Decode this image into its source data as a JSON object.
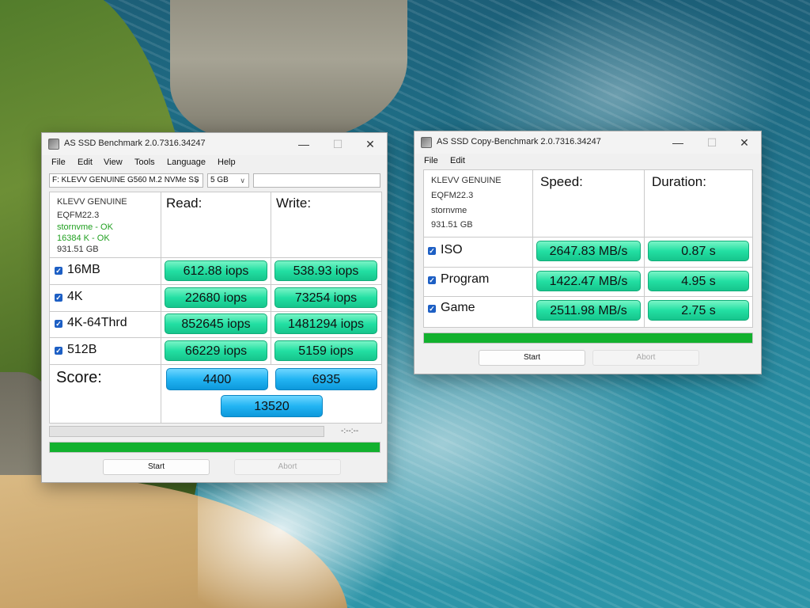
{
  "benchmark_window": {
    "title": "AS SSD Benchmark 2.0.7316.34247",
    "title_buttons": [
      "—",
      "☐",
      "✕"
    ],
    "menu": [
      "File",
      "Edit",
      "View",
      "Tools",
      "Language",
      "Help"
    ],
    "drive_select": "F: KLEVV GENUINE G560 M.2 NVMe SS",
    "size_select": "5 GB",
    "drive_info": [
      "KLEVV GENUINE",
      "EQFM22.3",
      "stornvme - OK",
      "16384 K - OK",
      "931.51 GB"
    ],
    "col_read": "Read:",
    "col_write": "Write:",
    "rows": [
      {
        "label": "16MB",
        "read": "612.88 iops",
        "write": "538.93 iops"
      },
      {
        "label": "4K",
        "read": "22680 iops",
        "write": "73254 iops"
      },
      {
        "label": "4K-64Thrd",
        "read": "852645 iops",
        "write": "1481294 iops"
      },
      {
        "label": "512B",
        "read": "66229 iops",
        "write": "5159 iops"
      }
    ],
    "score_label": "Score:",
    "score_read": "4400",
    "score_write": "6935",
    "score_total": "13520",
    "time_text": "-:--:--",
    "progress": 1.0,
    "start_label": "Start",
    "abort_label": "Abort"
  },
  "copy_window": {
    "title": "AS SSD Copy-Benchmark 2.0.7316.34247",
    "title_buttons": [
      "—",
      "☐",
      "✕"
    ],
    "menu": [
      "File",
      "Edit"
    ],
    "drive_info": [
      "KLEVV GENUINE",
      "EQFM22.3",
      "stornvme",
      "931.51 GB"
    ],
    "col_speed": "Speed:",
    "col_duration": "Duration:",
    "rows": [
      {
        "label": "ISO",
        "speed": "2647.83 MB/s",
        "duration": "0.87 s"
      },
      {
        "label": "Program",
        "speed": "1422.47 MB/s",
        "duration": "4.95 s"
      },
      {
        "label": "Game",
        "speed": "2511.98 MB/s",
        "duration": "2.75 s"
      }
    ],
    "progress": 1.0,
    "start_label": "Start",
    "abort_label": "Abort"
  },
  "colors": {
    "result_green": "#23dfa3",
    "score_blue": "#22b4f3",
    "progress_green": "#12b12e",
    "status_ok": "#21a021",
    "checkbox_blue": "#1d5fc4"
  }
}
